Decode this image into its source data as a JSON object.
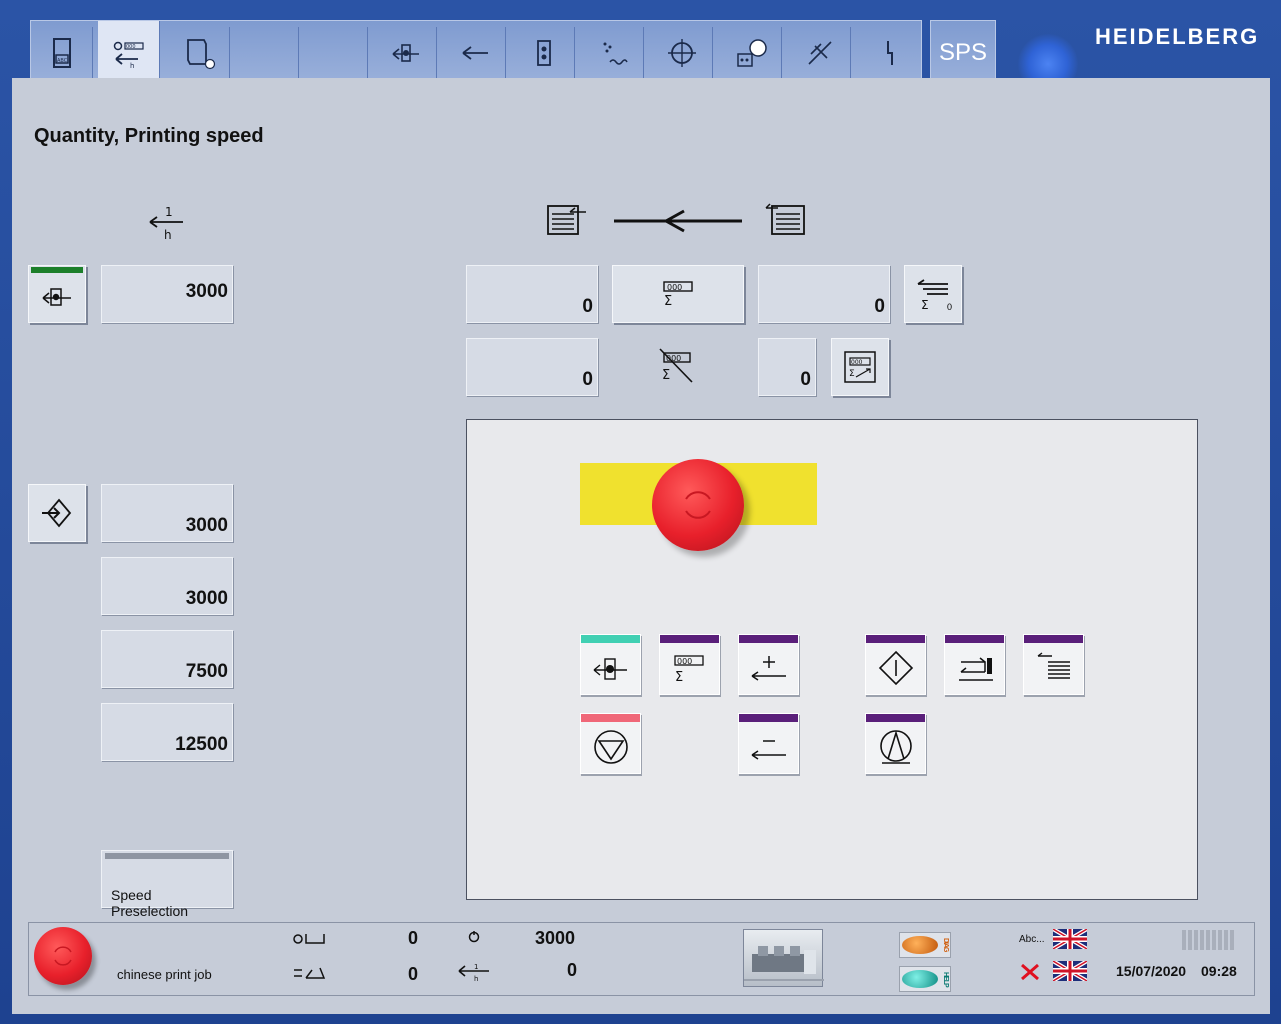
{
  "header": {
    "brand": "HEIDELBERG",
    "sps_label": "SPS",
    "toolbar_icons": [
      "abc-display-icon",
      "quantity-speed-icon",
      "job-document-icon",
      "blank-tab-1",
      "blank-tab-2",
      "feeder-icon",
      "delivery-arrow-icon",
      "register-icon",
      "dampening-icon",
      "print-unit-icon",
      "ink-palette-icon",
      "wash-icon",
      "power-icon"
    ],
    "active_tab": "quantity-speed-icon"
  },
  "page": {
    "title": "Quantity, Printing speed"
  },
  "speed": {
    "current_speed": "3000",
    "preset_1": "3000",
    "preset_2": "3000",
    "preset_3": "7500",
    "preset_4": "12500",
    "speed_preselection_label": "Speed Preselection"
  },
  "counters": {
    "total_left": "0",
    "total_right": "0",
    "waste_left": "0",
    "waste_right": "0",
    "reset_badge": "0"
  },
  "control_panel": {
    "colors": {
      "estop_yellow": "#f0e12e",
      "estop_red": "#e8202b",
      "cap_teal": "#41d0b3",
      "cap_purple": "#5a1f7a",
      "cap_pink": "#f06778"
    }
  },
  "status_bar": {
    "job_name": "chinese print job",
    "count_top": "0",
    "count_bottom": "0",
    "speed_top": "3000",
    "speed_bottom": "0",
    "diag_label": "DIAG",
    "help_label": "HELP",
    "lang_label": "Abc...",
    "date": "15/07/2020",
    "time": "09:28"
  }
}
